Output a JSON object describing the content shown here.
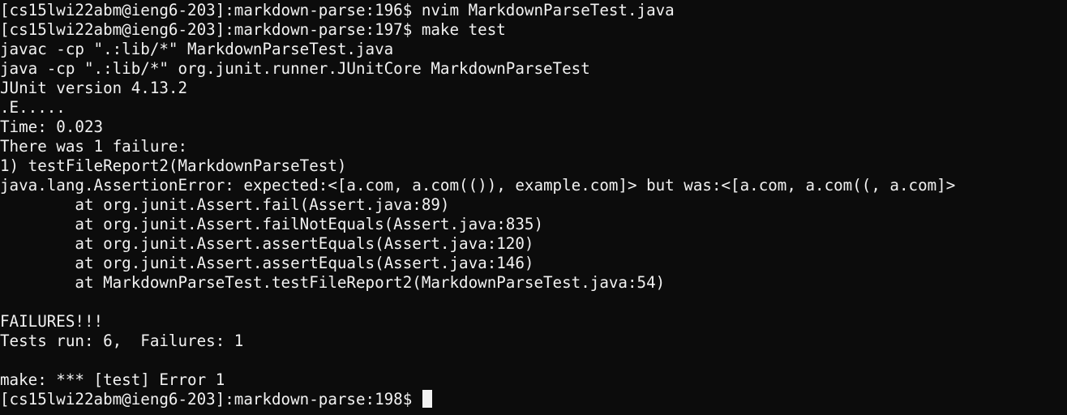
{
  "terminal": {
    "lines": [
      "[cs15lwi22abm@ieng6-203]:markdown-parse:196$ nvim MarkdownParseTest.java",
      "[cs15lwi22abm@ieng6-203]:markdown-parse:197$ make test",
      "javac -cp \".:lib/*\" MarkdownParseTest.java",
      "java -cp \".:lib/*\" org.junit.runner.JUnitCore MarkdownParseTest",
      "JUnit version 4.13.2",
      ".E.....",
      "Time: 0.023",
      "There was 1 failure:",
      "1) testFileReport2(MarkdownParseTest)",
      "java.lang.AssertionError: expected:<[a.com, a.com(()), example.com]> but was:<[a.com, a.com((, a.com]>",
      "        at org.junit.Assert.fail(Assert.java:89)",
      "        at org.junit.Assert.failNotEquals(Assert.java:835)",
      "        at org.junit.Assert.assertEquals(Assert.java:120)",
      "        at org.junit.Assert.assertEquals(Assert.java:146)",
      "        at MarkdownParseTest.testFileReport2(MarkdownParseTest.java:54)",
      "",
      "FAILURES!!!",
      "Tests run: 6,  Failures: 1",
      "",
      "make: *** [test] Error 1",
      "[cs15lwi22abm@ieng6-203]:markdown-parse:198$ "
    ]
  },
  "colors": {
    "background": "#0c0c0c",
    "foreground": "#f2f2f2",
    "cursor": "#f2f2f2"
  }
}
